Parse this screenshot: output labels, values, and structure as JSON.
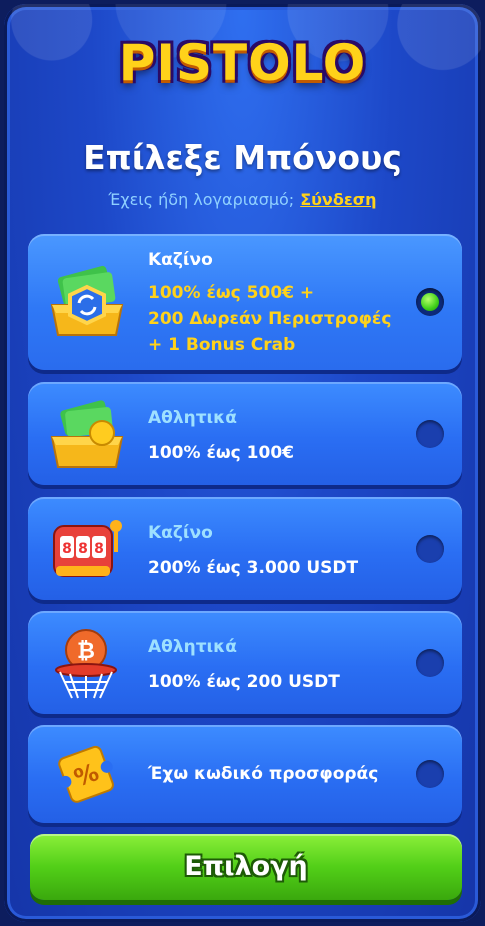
{
  "brand": {
    "logo_text": "PISTOLO"
  },
  "header": {
    "title": "Επίλεξε Μπόνους",
    "account_prompt": "Έχεις ήδη λογαριασμό;",
    "login_link": "Σύνδεση"
  },
  "bonuses": [
    {
      "category": "Καζίνο",
      "offer_lines": [
        "100% έως 500€ +",
        "200 Δωρεάν Περιστροφές",
        "+ 1 Bonus Crab"
      ],
      "icon": "cash-chest-icon",
      "selected": true
    },
    {
      "category": "Αθλητικά",
      "offer_lines": [
        "100% έως 100€"
      ],
      "icon": "cash-ball-chest-icon",
      "selected": false
    },
    {
      "category": "Καζίνο",
      "offer_lines": [
        "200% έως 3.000 USDT"
      ],
      "icon": "slot-machine-icon",
      "selected": false
    },
    {
      "category": "Αθλητικά",
      "offer_lines": [
        "100% έως 200 USDT"
      ],
      "icon": "bitcoin-basketball-icon",
      "selected": false
    },
    {
      "category": "",
      "offer_lines": [
        "Έχω κωδικό προσφοράς"
      ],
      "icon": "promo-ticket-icon",
      "selected": false
    }
  ],
  "footer": {
    "select_label": "Επιλογή"
  },
  "colors": {
    "accent_yellow": "#ffd21a",
    "button_green": "#52cf18",
    "card_blue": "#2a6ef3",
    "bg_blue": "#1d48c8"
  }
}
